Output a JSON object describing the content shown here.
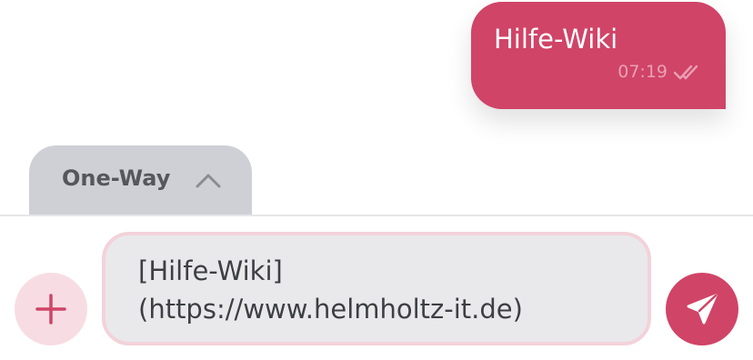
{
  "message": {
    "text": "Hilfe-Wiki",
    "time": "07:19",
    "status_icon": "double-check-icon"
  },
  "mode_tab": {
    "label": "One-Way",
    "icon": "chevron-up-icon"
  },
  "composer": {
    "add_icon": "plus-icon",
    "input_line1": "[Hilfe-Wiki]",
    "input_line2": "(https://www.helmholtz-it.de)",
    "send_icon": "send-icon"
  },
  "colors": {
    "accent": "#d04467",
    "tab_bg": "#cfd0d6",
    "input_bg": "#e9e9eb",
    "input_border": "#f3d2da",
    "plus_bg": "#f7dde3"
  }
}
